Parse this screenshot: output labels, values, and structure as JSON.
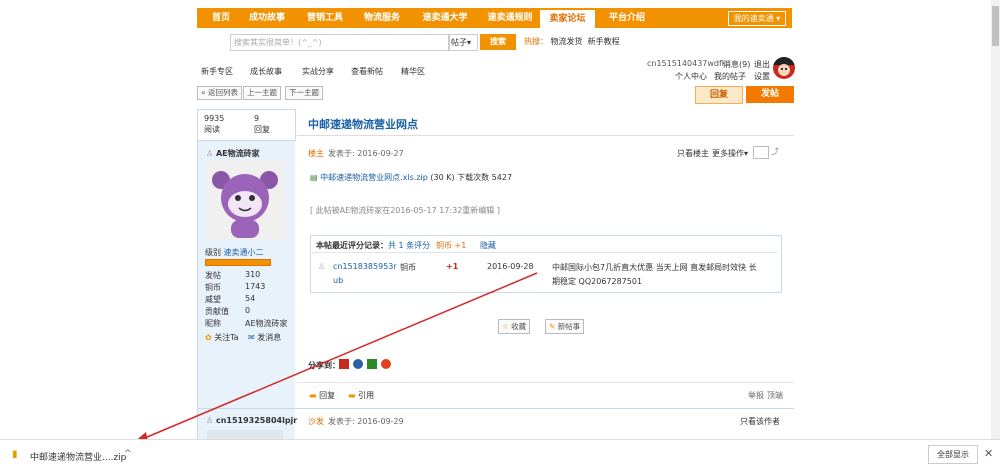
{
  "nav": {
    "items": [
      "首页",
      "成功故事",
      "营销工具",
      "物流服务",
      "速卖通大学",
      "速卖通规则",
      "卖家论坛",
      "平台介绍"
    ],
    "active_index": 6,
    "my_account": "我的速卖通"
  },
  "search": {
    "placeholder": "搜索其实很简单！(^_^)",
    "type_select": "帖子",
    "button": "搜索",
    "hot_label": "热搜：",
    "hot_words": [
      "物流发货",
      "新手教程"
    ]
  },
  "subtabs": [
    "新手专区",
    "成长故事",
    "实战分享",
    "查看新帖",
    "精华区"
  ],
  "user": {
    "name": "cn1515140437wdfk",
    "messages": "消息(9)",
    "logout": "退出",
    "personal_center": "个人中心",
    "my_posts": "我的帖子",
    "settings": "设置"
  },
  "pager": {
    "back": "« 返回列表",
    "prev": "上一主题",
    "next": "下一主题"
  },
  "actions": {
    "reply": "回复",
    "post": "发帖"
  },
  "thread": {
    "views": "9935",
    "views_label": "阅读",
    "replies": "9",
    "replies_label": "回复",
    "title": "中邮速递物流营业网点"
  },
  "post": {
    "author": "AE物流砖家",
    "role": "楼主",
    "posted": "发表于: 2016-09-27",
    "only_author": "只看楼主",
    "more_ops": "更多操作",
    "attachment_name": "中邮速递物流营业网点.xls.zip",
    "attachment_meta": "(30 K) 下载次数 5427",
    "edited_note": "[ 此帖被AE物流砖家在2016-05-17 17:32重新编辑 ]",
    "level_label": "级别",
    "level_value": "速卖通小二",
    "stats": [
      {
        "label": "发帖",
        "value": "310"
      },
      {
        "label": "铜币",
        "value": "1743"
      },
      {
        "label": "威望",
        "value": "54"
      },
      {
        "label": "贡献值",
        "value": "0"
      },
      {
        "label": "昵称",
        "value": "AE物流砖家"
      }
    ],
    "follow": "关注Ta",
    "message": "发消息",
    "rating": {
      "title": "本帖最近评分记录：",
      "count": "共 1 条评分",
      "coin": "铜币 +1",
      "hide": "隐藏",
      "user": "cn1518385953r",
      "user2": "ub",
      "type": "铜币",
      "amount": "+1",
      "date": "2016-09-28",
      "comment": "中邮国际小包7几折直大优惠 当天上网 直发邮局时效快 长",
      "comment2": "期稳定 QQ2067287501"
    },
    "favorite": "收藏",
    "new_post": "新帖事",
    "share_label": "分享到：",
    "reply": "回复",
    "quote": "引用",
    "report": "举报",
    "top": "顶端"
  },
  "next_post": {
    "author": "cn1519325804lpjr",
    "role": "沙发",
    "posted": "发表于: 2016-09-29",
    "only_author": "只看该作者"
  },
  "download": {
    "filename": "中邮速递物流营业....zip",
    "show_all": "全部显示"
  },
  "colors": {
    "accent": "#f39200",
    "link": "#1a5fa8",
    "red": "#c8281e"
  }
}
